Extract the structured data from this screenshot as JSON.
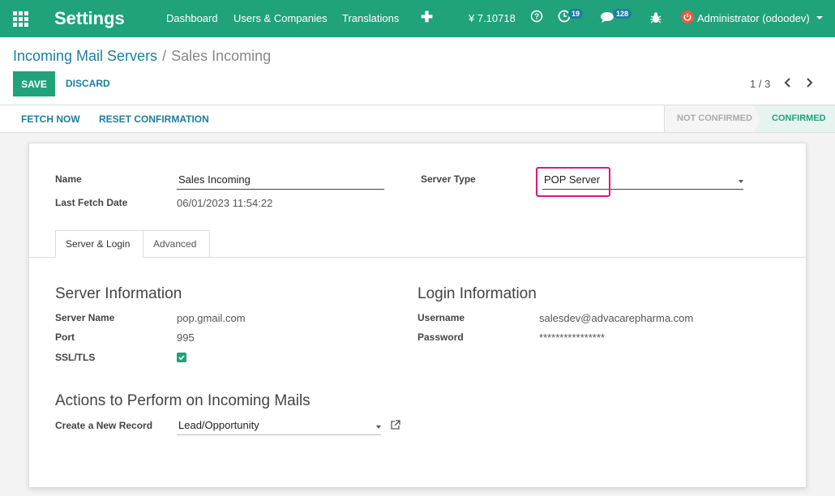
{
  "nav": {
    "brand": "Settings",
    "menu": [
      "Dashboard",
      "Users & Companies",
      "Translations"
    ],
    "currency": "¥ 7.10718",
    "activity_count": "19",
    "messages_count": "128",
    "user": "Administrator (odoodev)"
  },
  "breadcrumb": {
    "parent": "Incoming Mail Servers",
    "current": "Sales Incoming"
  },
  "actions": {
    "save": "SAVE",
    "discard": "DISCARD",
    "pager": "1 / 3"
  },
  "statusbar": {
    "fetch_now": "FETCH NOW",
    "reset": "RESET CONFIRMATION",
    "stages": [
      "NOT CONFIRMED",
      "CONFIRMED"
    ],
    "active_stage": "CONFIRMED"
  },
  "form": {
    "name_label": "Name",
    "name_value": "Sales Incoming",
    "last_fetch_label": "Last Fetch Date",
    "last_fetch_value": "06/01/2023 11:54:22",
    "server_type_label": "Server Type",
    "server_type_value": "POP Server",
    "tabs": [
      "Server & Login",
      "Advanced"
    ],
    "server_info": {
      "title": "Server Information",
      "server_name_label": "Server Name",
      "server_name_value": "pop.gmail.com",
      "port_label": "Port",
      "port_value": "995",
      "ssl_label": "SSL/TLS",
      "ssl_checked": true
    },
    "login_info": {
      "title": "Login Information",
      "username_label": "Username",
      "username_value": "salesdev@advacarepharma.com",
      "password_label": "Password",
      "password_value": "****************"
    },
    "actions_section": {
      "title": "Actions to Perform on Incoming Mails",
      "create_label": "Create a New Record",
      "create_value": "Lead/Opportunity"
    }
  },
  "colors": {
    "primary": "#20a27b",
    "link": "#1d7e9e",
    "highlight": "#e0177a"
  }
}
